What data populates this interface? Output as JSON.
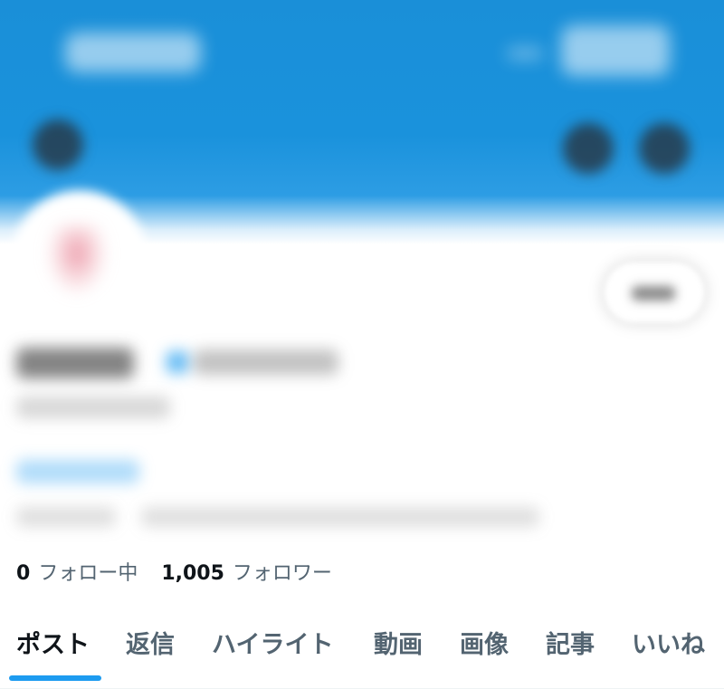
{
  "profile": {
    "following_count": "0",
    "following_label": "フォロー中",
    "followers_count": "1,005",
    "followers_label": "フォロワー"
  },
  "tabs": [
    {
      "label": "ポスト",
      "active": true
    },
    {
      "label": "返信",
      "active": false
    },
    {
      "label": "ハイライト",
      "active": false
    },
    {
      "label": "動画",
      "active": false
    },
    {
      "label": "画像",
      "active": false
    },
    {
      "label": "記事",
      "active": false
    },
    {
      "label": "いいね",
      "active": false
    }
  ],
  "colors": {
    "accent": "#1d9bf0",
    "banner": "#1a92dc",
    "primary_text": "#0f1419",
    "secondary_text": "#536471"
  },
  "icons": {
    "back": "back-arrow-icon",
    "search": "search-icon",
    "more": "more-icon"
  }
}
